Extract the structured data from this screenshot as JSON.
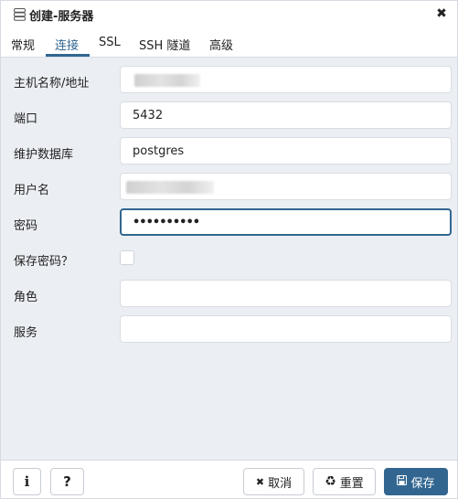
{
  "dialog": {
    "title": "创建-服务器",
    "close_glyph": "✖",
    "title_icon": "server-icon"
  },
  "tabs": [
    {
      "label": "常规",
      "active": false
    },
    {
      "label": "连接",
      "active": true
    },
    {
      "label": "SSL",
      "active": false
    },
    {
      "label": "SSH 隧道",
      "active": false
    },
    {
      "label": "高级",
      "active": false
    }
  ],
  "form": {
    "host": {
      "label": "主机名称/地址",
      "value": ""
    },
    "port": {
      "label": "端口",
      "value": "5432"
    },
    "maintenance_db": {
      "label": "维护数据库",
      "value": "postgres"
    },
    "username": {
      "label": "用户名",
      "value": ""
    },
    "password": {
      "label": "密码",
      "value": "••••••••••"
    },
    "save_password": {
      "label": "保存密码？",
      "checked": false
    },
    "role": {
      "label": "角色",
      "value": ""
    },
    "service": {
      "label": "服务",
      "value": ""
    }
  },
  "footer": {
    "info_glyph": "i",
    "help_glyph": "?",
    "cancel": {
      "icon": "✖",
      "label": "取消"
    },
    "reset": {
      "icon": "♻",
      "label": "重置"
    },
    "save": {
      "icon": "💾",
      "label": "保存"
    }
  },
  "colors": {
    "accent": "#326690",
    "background": "#ebeef3"
  }
}
